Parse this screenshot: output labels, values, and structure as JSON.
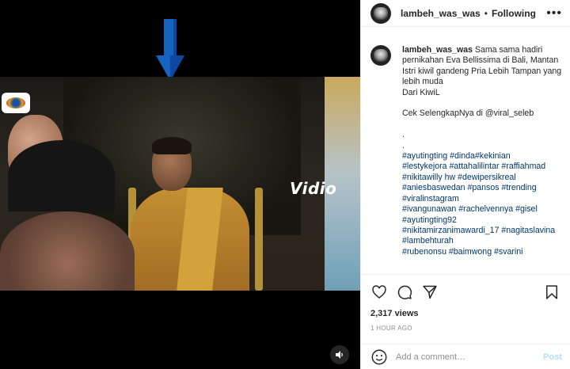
{
  "post": {
    "username": "lambeh_was_was",
    "separator": "•",
    "follow_label": "Following",
    "more_label": "•••"
  },
  "media": {
    "watermark": "Vidio"
  },
  "caption": {
    "username": "lambeh_was_was",
    "text": "Sama sama hadiri pernikahan Eva Bellissima di Bali, Mantan Istri kiwil gandeng Pria Lebih Tampan yang lebih muda\nDari KiwiL\n\nCek SelengkapNya di @viral_seleb\n\n.\n.",
    "hashtags": [
      "#ayutingting #dinda#kekinian",
      "#lestykejora #attahalilintar #raffiahmad",
      "#nikitawilly hw #dewipersikreal",
      "#aniesbaswedan #pansos #trending",
      "#viralinstagram",
      "#ivangunawan #rachelvennya #gisel",
      "#ayutingting92",
      "#nikitamirzanimawardi_17 #nagitaslavina",
      "#lambehturah",
      "#rubenonsu #baimwong #svarini"
    ]
  },
  "stats": {
    "views": "2,317 views",
    "time": "1 HOUR AGO"
  },
  "comment_box": {
    "placeholder": "Add a comment…",
    "post_label": "Post"
  },
  "colors": {
    "link": "#00376b",
    "post_disabled": "#b2dffc",
    "arrow": "#1565c0"
  }
}
